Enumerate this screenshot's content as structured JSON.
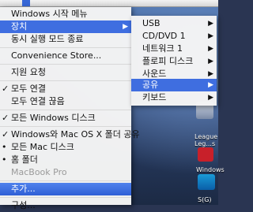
{
  "menu": {
    "items": [
      {
        "label": "Windows 시작 메뉴"
      },
      {
        "label": "장치"
      },
      {
        "label": "동시 실행 모드 종료"
      },
      {
        "label": "Convenience Store..."
      },
      {
        "label": "지원 요청"
      },
      {
        "label": "모두 연결",
        "check": "✓"
      },
      {
        "label": "모두 연결 끊음"
      },
      {
        "label": "모든 Windows 디스크",
        "check": "✓"
      },
      {
        "label": "Windows와 Mac OS X 폴더 공유",
        "check": "✓"
      },
      {
        "label": "모든 Mac 디스크",
        "check": "•"
      },
      {
        "label": "홈 폴더",
        "check": "•"
      },
      {
        "label": "MacBook Pro"
      },
      {
        "label": "추가..."
      },
      {
        "label": "구성..."
      }
    ]
  },
  "submenu": {
    "items": [
      {
        "label": "USB"
      },
      {
        "label": "CD/DVD 1"
      },
      {
        "label": "네트워크 1"
      },
      {
        "label": "플로피 디스크"
      },
      {
        "label": "사운드"
      },
      {
        "label": "공유"
      },
      {
        "label": "키보드"
      }
    ]
  },
  "desktop": {
    "labels": [
      "League",
      "Leg...s",
      "Windows",
      "S(G)"
    ]
  },
  "colors": {
    "highlight": "#3f6ee0",
    "menu_bg": "#f4f4f4"
  }
}
